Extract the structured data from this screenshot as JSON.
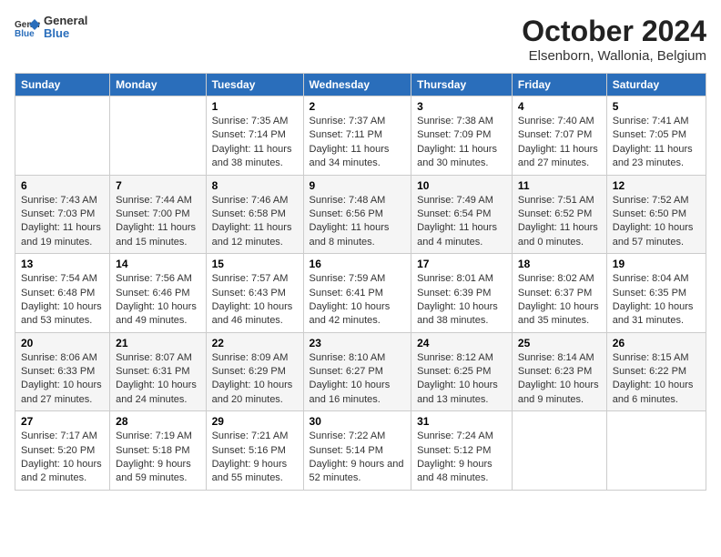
{
  "header": {
    "logo_general": "General",
    "logo_blue": "Blue",
    "title": "October 2024",
    "subtitle": "Elsenborn, Wallonia, Belgium"
  },
  "columns": [
    "Sunday",
    "Monday",
    "Tuesday",
    "Wednesday",
    "Thursday",
    "Friday",
    "Saturday"
  ],
  "weeks": [
    [
      {
        "day": "",
        "info": ""
      },
      {
        "day": "",
        "info": ""
      },
      {
        "day": "1",
        "info": "Sunrise: 7:35 AM\nSunset: 7:14 PM\nDaylight: 11 hours and 38 minutes."
      },
      {
        "day": "2",
        "info": "Sunrise: 7:37 AM\nSunset: 7:11 PM\nDaylight: 11 hours and 34 minutes."
      },
      {
        "day": "3",
        "info": "Sunrise: 7:38 AM\nSunset: 7:09 PM\nDaylight: 11 hours and 30 minutes."
      },
      {
        "day": "4",
        "info": "Sunrise: 7:40 AM\nSunset: 7:07 PM\nDaylight: 11 hours and 27 minutes."
      },
      {
        "day": "5",
        "info": "Sunrise: 7:41 AM\nSunset: 7:05 PM\nDaylight: 11 hours and 23 minutes."
      }
    ],
    [
      {
        "day": "6",
        "info": "Sunrise: 7:43 AM\nSunset: 7:03 PM\nDaylight: 11 hours and 19 minutes."
      },
      {
        "day": "7",
        "info": "Sunrise: 7:44 AM\nSunset: 7:00 PM\nDaylight: 11 hours and 15 minutes."
      },
      {
        "day": "8",
        "info": "Sunrise: 7:46 AM\nSunset: 6:58 PM\nDaylight: 11 hours and 12 minutes."
      },
      {
        "day": "9",
        "info": "Sunrise: 7:48 AM\nSunset: 6:56 PM\nDaylight: 11 hours and 8 minutes."
      },
      {
        "day": "10",
        "info": "Sunrise: 7:49 AM\nSunset: 6:54 PM\nDaylight: 11 hours and 4 minutes."
      },
      {
        "day": "11",
        "info": "Sunrise: 7:51 AM\nSunset: 6:52 PM\nDaylight: 11 hours and 0 minutes."
      },
      {
        "day": "12",
        "info": "Sunrise: 7:52 AM\nSunset: 6:50 PM\nDaylight: 10 hours and 57 minutes."
      }
    ],
    [
      {
        "day": "13",
        "info": "Sunrise: 7:54 AM\nSunset: 6:48 PM\nDaylight: 10 hours and 53 minutes."
      },
      {
        "day": "14",
        "info": "Sunrise: 7:56 AM\nSunset: 6:46 PM\nDaylight: 10 hours and 49 minutes."
      },
      {
        "day": "15",
        "info": "Sunrise: 7:57 AM\nSunset: 6:43 PM\nDaylight: 10 hours and 46 minutes."
      },
      {
        "day": "16",
        "info": "Sunrise: 7:59 AM\nSunset: 6:41 PM\nDaylight: 10 hours and 42 minutes."
      },
      {
        "day": "17",
        "info": "Sunrise: 8:01 AM\nSunset: 6:39 PM\nDaylight: 10 hours and 38 minutes."
      },
      {
        "day": "18",
        "info": "Sunrise: 8:02 AM\nSunset: 6:37 PM\nDaylight: 10 hours and 35 minutes."
      },
      {
        "day": "19",
        "info": "Sunrise: 8:04 AM\nSunset: 6:35 PM\nDaylight: 10 hours and 31 minutes."
      }
    ],
    [
      {
        "day": "20",
        "info": "Sunrise: 8:06 AM\nSunset: 6:33 PM\nDaylight: 10 hours and 27 minutes."
      },
      {
        "day": "21",
        "info": "Sunrise: 8:07 AM\nSunset: 6:31 PM\nDaylight: 10 hours and 24 minutes."
      },
      {
        "day": "22",
        "info": "Sunrise: 8:09 AM\nSunset: 6:29 PM\nDaylight: 10 hours and 20 minutes."
      },
      {
        "day": "23",
        "info": "Sunrise: 8:10 AM\nSunset: 6:27 PM\nDaylight: 10 hours and 16 minutes."
      },
      {
        "day": "24",
        "info": "Sunrise: 8:12 AM\nSunset: 6:25 PM\nDaylight: 10 hours and 13 minutes."
      },
      {
        "day": "25",
        "info": "Sunrise: 8:14 AM\nSunset: 6:23 PM\nDaylight: 10 hours and 9 minutes."
      },
      {
        "day": "26",
        "info": "Sunrise: 8:15 AM\nSunset: 6:22 PM\nDaylight: 10 hours and 6 minutes."
      }
    ],
    [
      {
        "day": "27",
        "info": "Sunrise: 7:17 AM\nSunset: 5:20 PM\nDaylight: 10 hours and 2 minutes."
      },
      {
        "day": "28",
        "info": "Sunrise: 7:19 AM\nSunset: 5:18 PM\nDaylight: 9 hours and 59 minutes."
      },
      {
        "day": "29",
        "info": "Sunrise: 7:21 AM\nSunset: 5:16 PM\nDaylight: 9 hours and 55 minutes."
      },
      {
        "day": "30",
        "info": "Sunrise: 7:22 AM\nSunset: 5:14 PM\nDaylight: 9 hours and 52 minutes."
      },
      {
        "day": "31",
        "info": "Sunrise: 7:24 AM\nSunset: 5:12 PM\nDaylight: 9 hours and 48 minutes."
      },
      {
        "day": "",
        "info": ""
      },
      {
        "day": "",
        "info": ""
      }
    ]
  ]
}
